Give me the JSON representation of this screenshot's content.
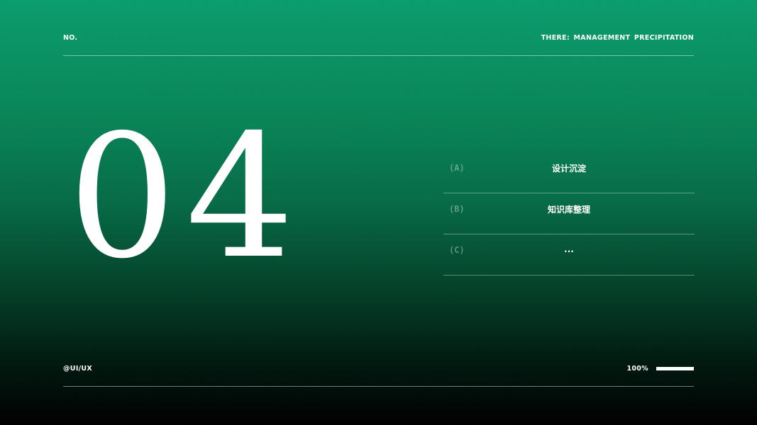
{
  "header": {
    "left_label": "NO.",
    "right_label": "THERE: MANAGEMENT PRECIPITATION"
  },
  "section_number": {
    "first_digit": "0",
    "second_digit": "4"
  },
  "items": [
    {
      "key": "(A)",
      "label": "设计沉淀"
    },
    {
      "key": "(B)",
      "label": "知识库整理"
    },
    {
      "key": "(C)",
      "label": "..."
    }
  ],
  "footer": {
    "left_label": "@UI/UX",
    "progress_text": "100%",
    "progress_value": 1.0
  },
  "colors": {
    "gradient_top": "#0b9d6e",
    "gradient_bottom": "#000000",
    "text": "#ffffff"
  }
}
